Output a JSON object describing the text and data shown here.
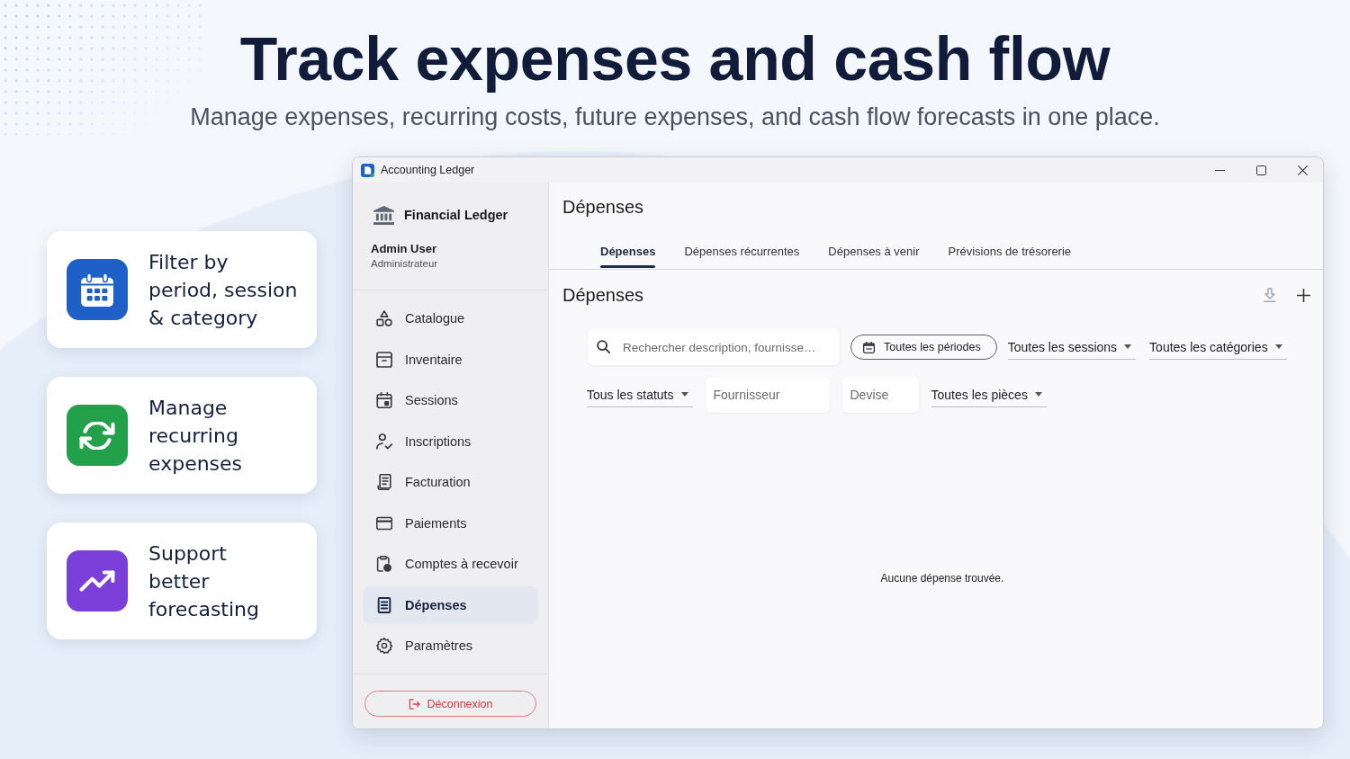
{
  "hero": {
    "title": "Track expenses and cash flow",
    "subtitle": "Manage expenses, recurring costs, future expenses, and cash flow forecasts in one place."
  },
  "features": [
    {
      "text": "Filter by\nperiod, session\n& category",
      "color": "#1f5fc8"
    },
    {
      "text": "Manage\nrecurring\nexpenses",
      "color": "#22a04a"
    },
    {
      "text": "Support\nbetter\nforecasting",
      "color": "#7a3fd8"
    }
  ],
  "window": {
    "title": "Accounting Ledger"
  },
  "sidebar": {
    "brand": "Financial Ledger",
    "user": {
      "name": "Admin User",
      "role": "Administrateur"
    },
    "items": [
      {
        "label": "Catalogue",
        "selected": false
      },
      {
        "label": "Inventaire",
        "selected": false
      },
      {
        "label": "Sessions",
        "selected": false
      },
      {
        "label": "Inscriptions",
        "selected": false
      },
      {
        "label": "Facturation",
        "selected": false
      },
      {
        "label": "Paiements",
        "selected": false
      },
      {
        "label": "Comptes à recevoir",
        "selected": false
      },
      {
        "label": "Dépenses",
        "selected": true
      },
      {
        "label": "Paramètres",
        "selected": false
      }
    ],
    "logout": "Déconnexion"
  },
  "main": {
    "title": "Dépenses",
    "tabs": [
      {
        "label": "Dépenses",
        "selected": true
      },
      {
        "label": "Dépenses récurrentes",
        "selected": false
      },
      {
        "label": "Dépenses à venir",
        "selected": false
      },
      {
        "label": "Prévisions de trésorerie",
        "selected": false
      }
    ],
    "section_title": "Dépenses",
    "filters": {
      "search": {
        "placeholder": "Rechercher description, fournisse…"
      },
      "period": "Toutes les périodes",
      "session": {
        "value": "Toutes les sessions"
      },
      "category": {
        "value": "Toutes les catégories"
      },
      "status": {
        "value": "Tous les statuts"
      },
      "supplier": {
        "placeholder": "Fournisseur"
      },
      "currency": {
        "placeholder": "Devise"
      },
      "attachment": {
        "value": "Toutes les pièces"
      }
    },
    "empty_message": "Aucune dépense trouvée."
  }
}
